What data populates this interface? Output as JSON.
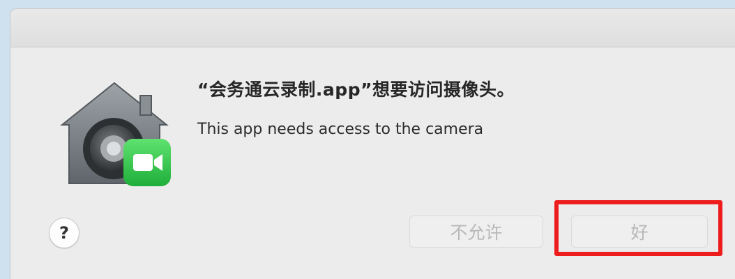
{
  "dialog": {
    "title": "“会务通云录制.app”想要访问摄像头。",
    "message": "This app needs access to the camera",
    "icon": "security-camera-icon",
    "help_label": "?",
    "deny_label": "不允许",
    "ok_label": "好"
  },
  "colors": {
    "highlight": "#ee1d1d",
    "facetime_green": "#34c759",
    "dialog_bg": "#ececec"
  }
}
